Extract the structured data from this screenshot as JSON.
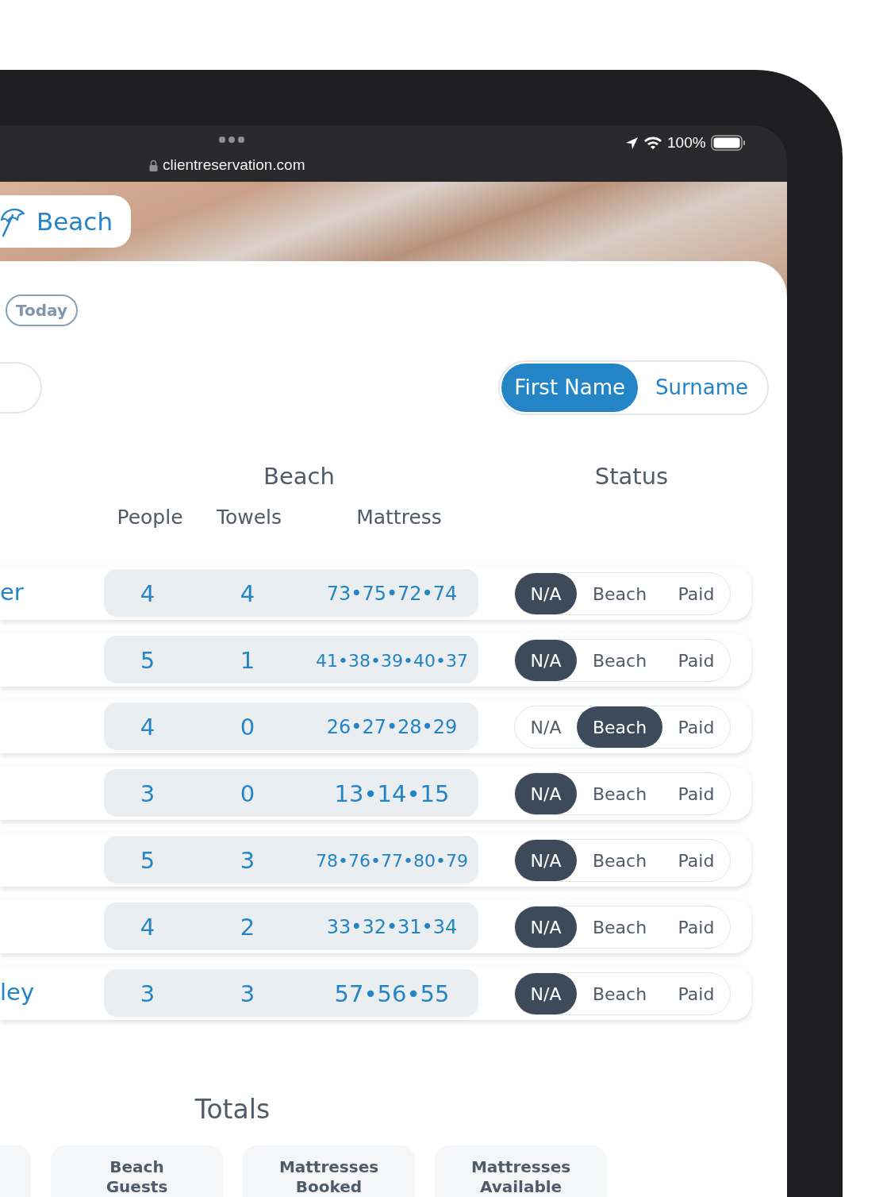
{
  "browser": {
    "url": "clientreservation.com",
    "battery": "100%"
  },
  "header": {
    "title": "Beach"
  },
  "today_button": "Today",
  "name_toggle": [
    {
      "label": "First Name",
      "selected": true
    },
    {
      "label": "Surname",
      "selected": false
    }
  ],
  "table": {
    "group_headers": [
      "Beach",
      "Status"
    ],
    "columns": [
      "People",
      "Towels",
      "Mattress"
    ],
    "rows": [
      {
        "name": "er",
        "people": "4",
        "towels": "4",
        "mattress": "73•75•72•74",
        "status": [
          {
            "label": "N/A",
            "selected": true
          },
          {
            "label": "Beach",
            "selected": false
          },
          {
            "label": "Paid",
            "selected": false
          }
        ]
      },
      {
        "people": "5",
        "towels": "1",
        "mattress": "41•38•39•40•37",
        "status": [
          {
            "label": "N/A",
            "selected": true
          },
          {
            "label": "Beach",
            "selected": false
          },
          {
            "label": "Paid",
            "selected": false
          }
        ]
      },
      {
        "people": "4",
        "towels": "0",
        "mattress": "26•27•28•29",
        "status": [
          {
            "label": "N/A",
            "selected": false
          },
          {
            "label": "Beach",
            "selected": true
          },
          {
            "label": "Paid",
            "selected": false
          }
        ]
      },
      {
        "people": "3",
        "towels": "0",
        "mattress": "13•14•15",
        "status": [
          {
            "label": "N/A",
            "selected": true
          },
          {
            "label": "Beach",
            "selected": false
          },
          {
            "label": "Paid",
            "selected": false
          }
        ]
      },
      {
        "people": "5",
        "towels": "3",
        "mattress": "78•76•77•80•79",
        "status": [
          {
            "label": "N/A",
            "selected": true
          },
          {
            "label": "Beach",
            "selected": false
          },
          {
            "label": "Paid",
            "selected": false
          }
        ]
      },
      {
        "people": "4",
        "towels": "2",
        "mattress": "33•32•31•34",
        "status": [
          {
            "label": "N/A",
            "selected": true
          },
          {
            "label": "Beach",
            "selected": false
          },
          {
            "label": "Paid",
            "selected": false
          }
        ]
      },
      {
        "name": "ley",
        "people": "3",
        "towels": "3",
        "mattress": "57•56•55",
        "status": [
          {
            "label": "N/A",
            "selected": true
          },
          {
            "label": "Beach",
            "selected": false
          },
          {
            "label": "Paid",
            "selected": false
          }
        ]
      }
    ]
  },
  "totals": {
    "title": "Totals",
    "tiles": [
      {
        "kind": "cut_off"
      },
      {
        "kind": "labeled",
        "label": "Beach Guests"
      },
      {
        "kind": "labeled",
        "label": "Mattresses Booked"
      },
      {
        "kind": "labeled",
        "label": "Mattresses Available"
      }
    ]
  }
}
